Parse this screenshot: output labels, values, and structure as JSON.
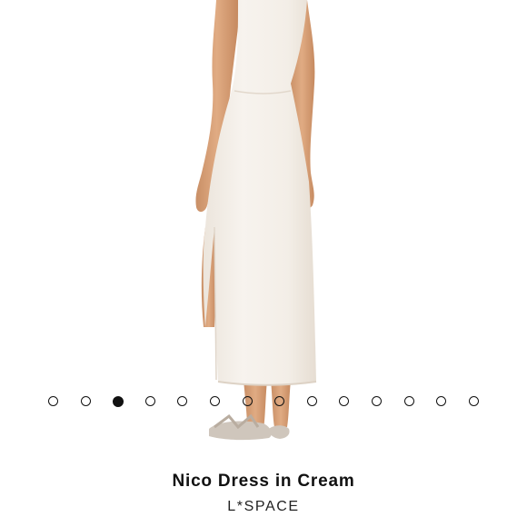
{
  "product": {
    "name": "Nico Dress in Cream",
    "brand": "L*SPACE",
    "image_icon": "product-photo"
  },
  "carousel": {
    "total_slides": 14,
    "active_index": 2
  },
  "colors": {
    "dot": "#111111",
    "dress": "#f4efe8",
    "skin": "#d9a37b",
    "background": "#ffffff"
  }
}
